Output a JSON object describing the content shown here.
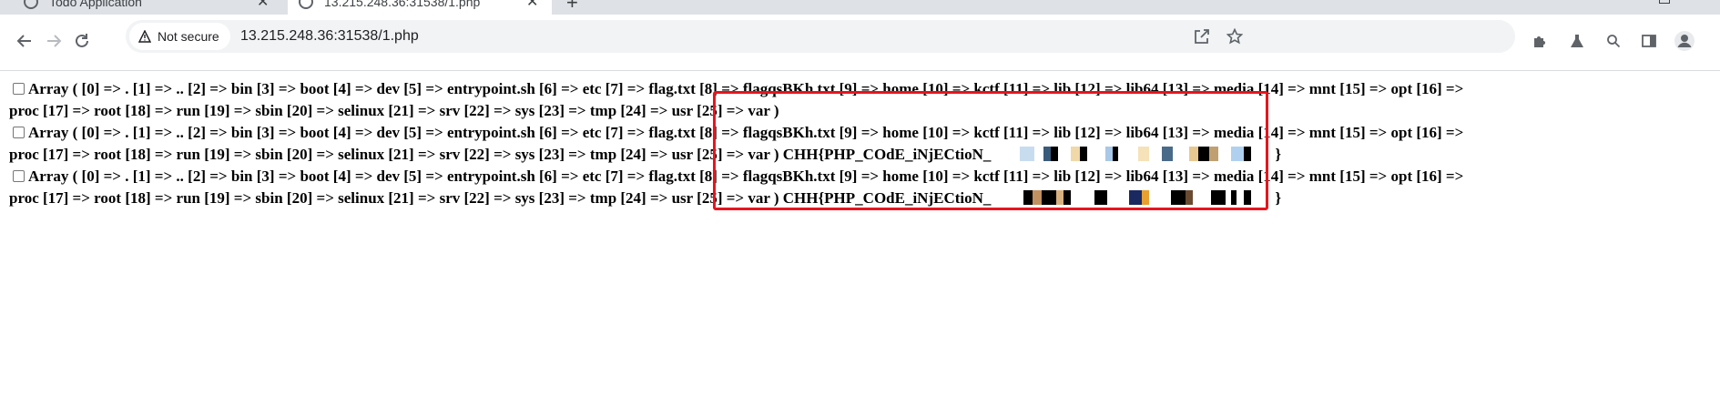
{
  "browser": {
    "tabs": [
      {
        "title": "Todo Application",
        "active": false
      },
      {
        "title": "13.215.248.36:31538/1.php",
        "active": true
      }
    ],
    "new_tab_label": "+",
    "tab_close_label": "✕",
    "security_label": "Not secure",
    "url": "13.215.248.36:31538/1.php",
    "icons": {
      "back": "back-arrow-icon",
      "forward": "forward-arrow-icon",
      "reload": "reload-icon",
      "warning": "warning-triangle-icon",
      "share": "share-icon",
      "bookmark": "star-icon",
      "extensions": "puzzle-icon",
      "lab": "flask-icon",
      "search": "search-icon",
      "sidepanel": "side-panel-icon",
      "profile": "profile-avatar-icon"
    }
  },
  "page": {
    "lines": [
      {
        "text": "Array ( [0] => . [1] => .. [2] => bin [3] => boot [4] => dev [5] => entrypoint.sh [6] => etc [7] => flag.txt [8] => flagqsBKh.txt [9] => home [10] => kctf [11] => lib [12] => lib64 [13] => media [14] => mnt [15] => opt [16] =>",
        "has_checkbox": true
      },
      {
        "text": "proc [17] => root [18] => run [19] => sbin [20] => selinux [21] => srv [22] => sys [23] => tmp [24] => usr [25] => var )",
        "has_checkbox": false
      },
      {
        "text": "Array ( [0] => . [1] => .. [2] => bin [3] => boot [4] => dev [5] => entrypoint.sh [6] => etc [7] => flag.txt [8] => flagqsBKh.txt [9] => home [10] => kctf [11] => lib [12] => lib64 [13] => media [14] => mnt [15] => opt [16] =>",
        "has_checkbox": true
      },
      {
        "text": "proc [17] => root [18] => run [19] => sbin [20] => selinux [21] => srv [22] => sys [23] => tmp [24] => usr [25] => var ) CHH{PHP_COdE_iNjECtioN_",
        "suffix": "}",
        "has_checkbox": false,
        "redacted": true
      },
      {
        "text": "Array ( [0] => . [1] => .. [2] => bin [3] => boot [4] => dev [5] => entrypoint.sh [6] => etc [7] => flag.txt [8] => flagqsBKh.txt [9] => home [10] => kctf [11] => lib [12] => lib64 [13] => media [14] => mnt [15] => opt [16] =>",
        "has_checkbox": true
      },
      {
        "text": "proc [17] => root [18] => run [19] => sbin [20] => selinux [21] => srv [22] => sys [23] => tmp [24] => usr [25] => var ) CHH{PHP_COdE_iNjECtioN_",
        "suffix": "}",
        "has_checkbox": false,
        "redacted": true
      }
    ]
  },
  "annotation": {
    "box_color": "#e8141e"
  }
}
